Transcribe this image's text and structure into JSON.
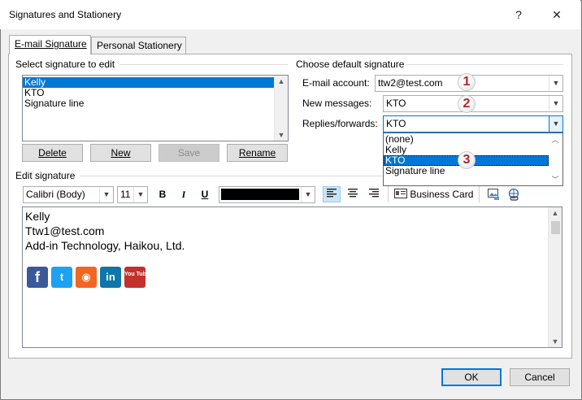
{
  "window": {
    "title": "Signatures and Stationery",
    "help_glyph": "?",
    "close_glyph": "✕"
  },
  "tabs": [
    {
      "label": "E-mail Signature",
      "mnemonic_index": 0
    },
    {
      "label": "Personal Stationery",
      "mnemonic_index": 0
    }
  ],
  "select_signature": {
    "heading": "Select signature to edit",
    "items": [
      "Kelly",
      "KTO",
      "Signature line"
    ],
    "selected_index": 0
  },
  "sig_buttons": {
    "delete": "Delete",
    "new": "New",
    "save": "Save",
    "rename": "Rename"
  },
  "default_signature": {
    "heading": "Choose default signature",
    "email_account_label": "E-mail account:",
    "email_account_value": "ttw2@test.com",
    "new_messages_label": "New messages:",
    "new_messages_value": "KTO",
    "replies_label": "Replies/forwards:",
    "replies_value": "KTO",
    "dropdown_options": [
      "(none)",
      "Kelly",
      "KTO",
      "Signature line"
    ],
    "dropdown_selected_index": 2
  },
  "badges": [
    "1",
    "2",
    "3"
  ],
  "edit_signature": {
    "heading": "Edit signature",
    "font_name": "Calibri (Body)",
    "font_size": "11",
    "bold": "B",
    "italic": "I",
    "underline": "U",
    "text_color": "#000000",
    "business_card_label": "Business Card",
    "alignment_selected": "left",
    "lines": [
      "Kelly",
      "Ttw1@test.com",
      "Add-in Technology, Haikou, Ltd."
    ],
    "social_icons": [
      {
        "name": "facebook-icon",
        "glyph": "f",
        "color": "#3b5998"
      },
      {
        "name": "twitter-icon",
        "glyph": "t",
        "color": "#1da1f2"
      },
      {
        "name": "rss-icon",
        "glyph": "◉",
        "color": "#f26522"
      },
      {
        "name": "linkedin-icon",
        "glyph": "in",
        "color": "#0e76a8"
      },
      {
        "name": "youtube-icon",
        "glyph": "You Tube",
        "color": "#c4302b"
      }
    ]
  },
  "footer": {
    "ok": "OK",
    "cancel": "Cancel"
  },
  "colors": {
    "accent": "#0078d7",
    "badge_text": "#b3242b"
  }
}
